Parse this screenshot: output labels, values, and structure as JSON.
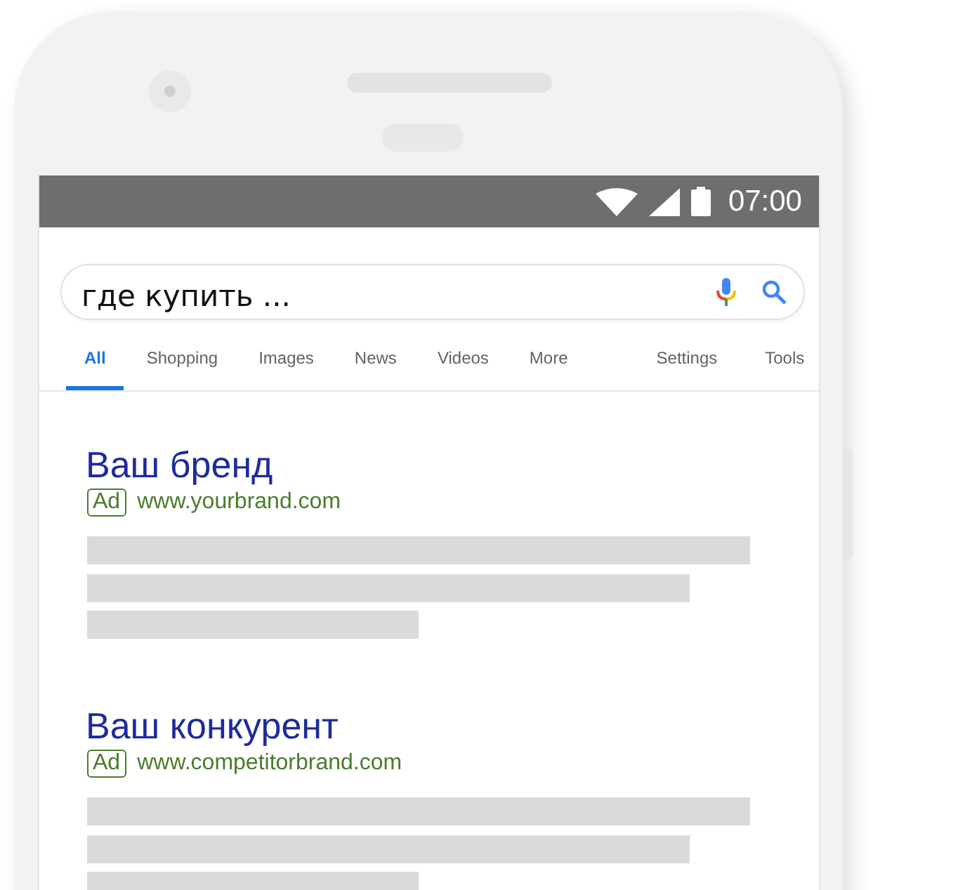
{
  "status_bar": {
    "time": "07:00"
  },
  "search": {
    "value": "где купить ..."
  },
  "tabs": [
    {
      "label": "All",
      "selected": true
    },
    {
      "label": "Shopping",
      "selected": false
    },
    {
      "label": "Images",
      "selected": false
    },
    {
      "label": "News",
      "selected": false
    },
    {
      "label": "Videos",
      "selected": false
    },
    {
      "label": "More",
      "selected": false
    }
  ],
  "tools": [
    "Settings",
    "Tools"
  ],
  "results": [
    {
      "title": "Ваш бренд",
      "badge": "Ad",
      "url": "www.yourbrand.com"
    },
    {
      "title": "Ваш конкурент",
      "badge": "Ad",
      "url": "www.competitorbrand.com"
    }
  ]
}
